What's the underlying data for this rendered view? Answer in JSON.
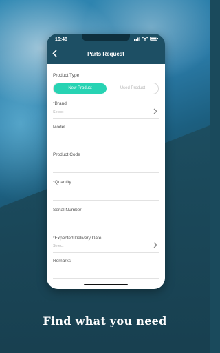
{
  "status": {
    "time": "16:48"
  },
  "header": {
    "title": "Parts Request"
  },
  "form": {
    "product_type_label": "Product Type",
    "product_type_options": [
      "New Product",
      "Used Product"
    ],
    "brand_label": "*Brand",
    "brand_value": "Select",
    "model_label": "Model",
    "product_code_label": "Product Code",
    "quantity_label": "*Quantity",
    "serial_number_label": "Serial Number",
    "delivery_date_label": "*Expected Delivery Date",
    "delivery_date_value": "Select",
    "remarks_label": "Remarks"
  },
  "tagline": "Find what you need",
  "colors": {
    "accent": "#27d3b3",
    "header": "#1d4f64"
  },
  "icons": [
    "back-arrow-icon",
    "signal-icon",
    "wifi-icon",
    "battery-icon",
    "chevron-right-icon"
  ]
}
